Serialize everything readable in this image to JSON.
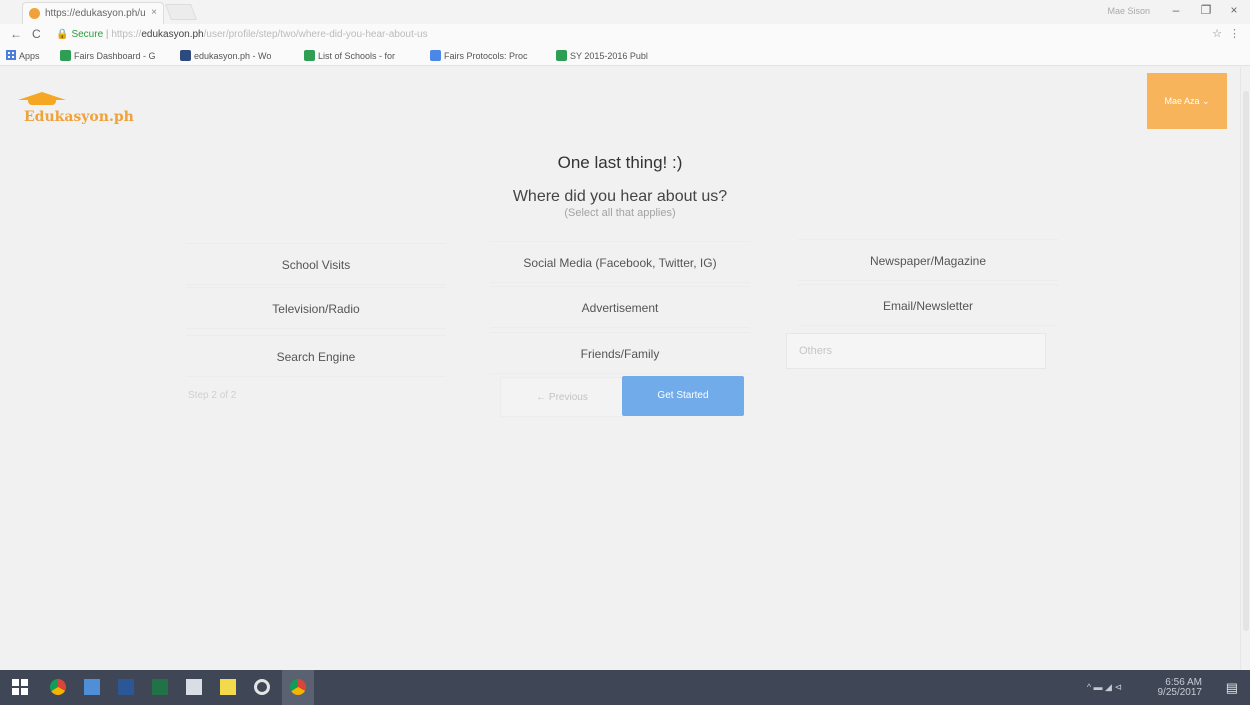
{
  "browser": {
    "tab_title": "https://edukasyon.ph/u",
    "tab_close": "×",
    "profile_name": "Mae Sison",
    "window_controls": {
      "minimize": "–",
      "restore": "❐",
      "close": "×"
    },
    "nav": {
      "back": "←",
      "reload": "C"
    },
    "address": {
      "lock": "🔒",
      "secure_label": "Secure",
      "protocol": "https://",
      "host": "edukasyon.ph",
      "path": "/user/profile/step/two/where-did-you-hear-about-us"
    },
    "star": "☆",
    "menu": "⋮",
    "bookmarks": [
      {
        "label": "Apps",
        "icon": "apps-grid-icon",
        "color": "#4d7edb"
      },
      {
        "label": "Fairs Dashboard - G",
        "icon": "sheets-icon",
        "color": "#2e9e54"
      },
      {
        "label": "edukasyon.ph - Wo",
        "icon": "p-icon",
        "color": "#2c4a80"
      },
      {
        "label": "List of Schools - for",
        "icon": "sheets-icon",
        "color": "#2e9e54"
      },
      {
        "label": "Fairs Protocols: Proc",
        "icon": "docs-icon",
        "color": "#4a87e6"
      },
      {
        "label": "SY 2015-2016 Publ",
        "icon": "sheets-icon",
        "color": "#2e9e54"
      }
    ]
  },
  "header": {
    "logo_text": "Edukasyon.ph",
    "user_menu_label": "Mae Aza ⌄",
    "accent_color": "#f8b45a"
  },
  "form": {
    "title": "One last thing! :)",
    "question": "Where did you hear about us?",
    "hint": "(Select all that applies)",
    "options": [
      "School Visits",
      "Social Media (Facebook, Twitter, IG)",
      "Newspaper/Magazine",
      "Television/Radio",
      "Advertisement",
      "Email/Newsletter",
      "Search Engine",
      "Friends/Family"
    ],
    "others_placeholder": "Others",
    "step_label": "Step 2 of 2",
    "previous_label": "← Previous",
    "submit_label": "Get Started",
    "submit_color": "#71abea"
  },
  "taskbar": {
    "apps": [
      "windows-icon",
      "chrome-icon",
      "file-explorer-icon",
      "word-icon",
      "excel-icon",
      "mail-icon",
      "sticky-notes-icon",
      "settings-icon",
      "chrome-icon"
    ],
    "tray_icons": "^  ▬  ◢  ⊲",
    "time": "6:56 AM",
    "date": "9/25/2017",
    "notification": "▤"
  }
}
